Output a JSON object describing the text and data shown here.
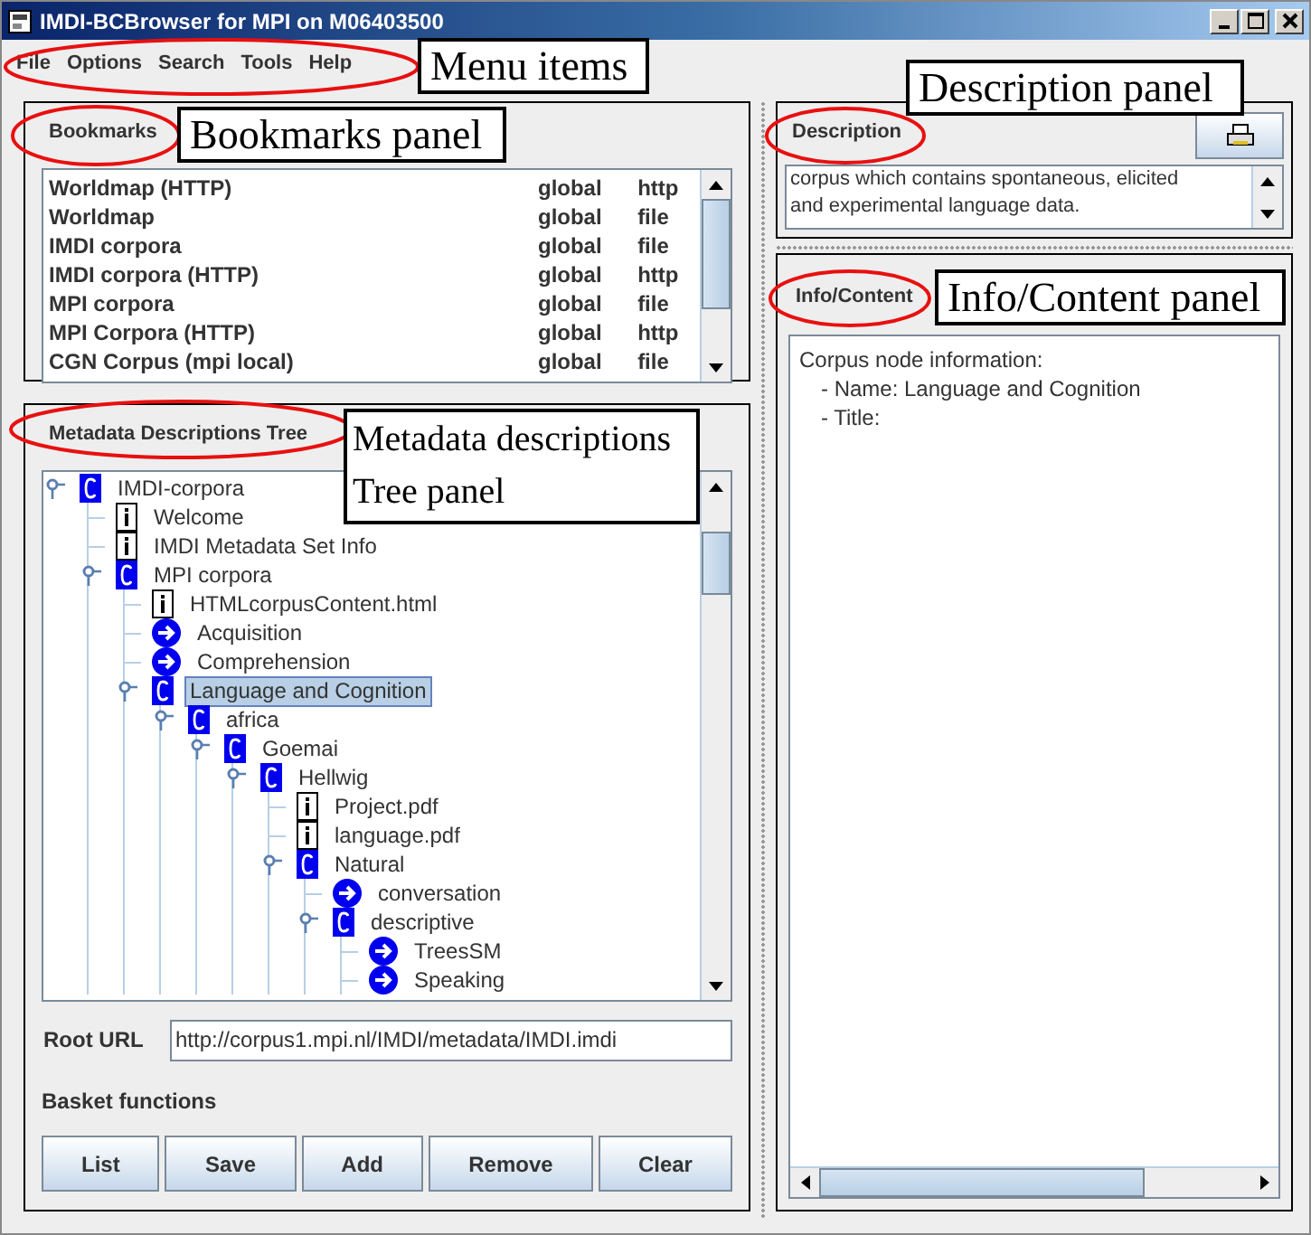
{
  "window": {
    "title": "IMDI-BCBrowser for MPI on M06403500"
  },
  "menu": [
    {
      "label": "File"
    },
    {
      "label": "Options"
    },
    {
      "label": "Search"
    },
    {
      "label": "Tools"
    },
    {
      "label": "Help"
    }
  ],
  "bookmarks": {
    "title": "Bookmarks",
    "rows": [
      {
        "name": "Worldmap (HTTP)",
        "scope": "global",
        "protocol": "http"
      },
      {
        "name": "Worldmap",
        "scope": "global",
        "protocol": "file"
      },
      {
        "name": "IMDI corpora",
        "scope": "global",
        "protocol": "file"
      },
      {
        "name": "IMDI corpora (HTTP)",
        "scope": "global",
        "protocol": "http"
      },
      {
        "name": "MPI corpora",
        "scope": "global",
        "protocol": "file"
      },
      {
        "name": "MPI Corpora (HTTP)",
        "scope": "global",
        "protocol": "http"
      },
      {
        "name": "CGN Corpus (mpi local)",
        "scope": "global",
        "protocol": "file"
      }
    ]
  },
  "tree": {
    "title": "Metadata Descriptions Tree",
    "nodes": [
      {
        "label": "IMDI-corpora",
        "kind": "corpus",
        "expanded": true,
        "selected": false,
        "children": [
          {
            "label": "Welcome",
            "kind": "info",
            "selected": false
          },
          {
            "label": "IMDI Metadata Set Info",
            "kind": "info",
            "selected": false
          },
          {
            "label": "MPI corpora",
            "kind": "corpus",
            "expanded": true,
            "selected": false,
            "children": [
              {
                "label": "HTMLcorpusContent.html",
                "kind": "info",
                "selected": false
              },
              {
                "label": "Acquisition",
                "kind": "link",
                "selected": false
              },
              {
                "label": "Comprehension",
                "kind": "link",
                "selected": false
              },
              {
                "label": "Language and Cognition",
                "kind": "corpus",
                "expanded": true,
                "selected": true,
                "children": [
                  {
                    "label": "africa",
                    "kind": "corpus",
                    "expanded": true,
                    "selected": false,
                    "children": [
                      {
                        "label": "Goemai",
                        "kind": "corpus",
                        "expanded": true,
                        "selected": false,
                        "children": [
                          {
                            "label": "Hellwig",
                            "kind": "corpus",
                            "expanded": true,
                            "selected": false,
                            "children": [
                              {
                                "label": "Project.pdf",
                                "kind": "info",
                                "selected": false
                              },
                              {
                                "label": "language.pdf",
                                "kind": "info",
                                "selected": false
                              },
                              {
                                "label": "Natural",
                                "kind": "corpus",
                                "expanded": true,
                                "selected": false,
                                "children": [
                                  {
                                    "label": "conversation",
                                    "kind": "link",
                                    "selected": false
                                  },
                                  {
                                    "label": "descriptive",
                                    "kind": "corpus",
                                    "expanded": true,
                                    "selected": false,
                                    "children": [
                                      {
                                        "label": "TreesSM",
                                        "kind": "link",
                                        "selected": false
                                      },
                                      {
                                        "label": "Speaking",
                                        "kind": "link",
                                        "selected": false
                                      }
                                    ]
                                  }
                                ]
                              }
                            ]
                          }
                        ]
                      }
                    ]
                  }
                ]
              }
            ]
          }
        ]
      }
    ]
  },
  "root_url": {
    "label": "Root URL",
    "value": "http://corpus1.mpi.nl/IMDI/metadata/IMDI.imdi"
  },
  "basket": {
    "title": "Basket functions",
    "buttons": [
      {
        "label": "List"
      },
      {
        "label": "Save"
      },
      {
        "label": "Add"
      },
      {
        "label": "Remove"
      },
      {
        "label": "Clear"
      }
    ]
  },
  "description": {
    "title": "Description",
    "lines": [
      "corpus which contains spontaneous, elicited",
      "and experimental language data."
    ]
  },
  "info": {
    "title": "Info/Content",
    "lines": [
      {
        "text": "Corpus node information:",
        "indent": false
      },
      {
        "text": "- Name: Language and Cognition",
        "indent": true
      },
      {
        "text": "- Title:",
        "indent": true
      }
    ]
  },
  "callouts": [
    {
      "text": "Menu items"
    },
    {
      "text": "Bookmarks panel"
    },
    {
      "text": "Metadata descriptions Tree panel"
    },
    {
      "text": "Description panel"
    },
    {
      "text": "Info/Content panel"
    }
  ]
}
